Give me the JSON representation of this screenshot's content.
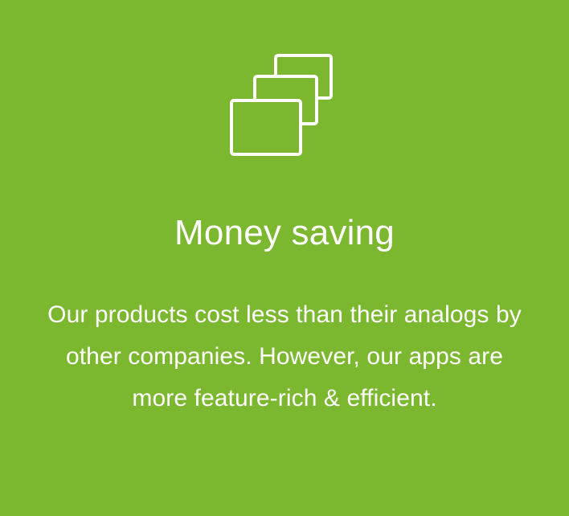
{
  "colors": {
    "background": "#7bb82f",
    "foreground": "#ffffff"
  },
  "feature": {
    "icon": "stacked-cards-icon",
    "title": "Money saving",
    "description": "Our products cost less than their analogs by other companies. However, our apps are more feature-rich & efficient."
  }
}
